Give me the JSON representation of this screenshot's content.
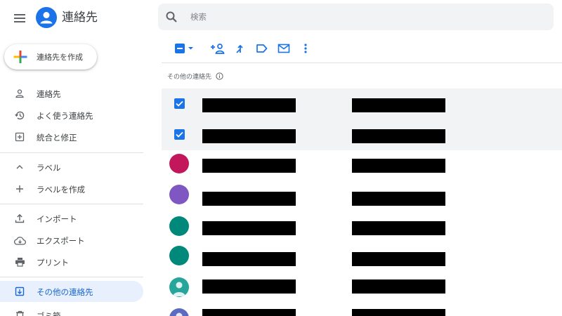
{
  "app": {
    "title": "連絡先",
    "create_label": "連絡先を作成"
  },
  "sidebar": {
    "items": [
      {
        "label": "連絡先",
        "icon": "person-icon"
      },
      {
        "label": "よく使う連絡先",
        "icon": "history-icon"
      },
      {
        "label": "統合と修正",
        "icon": "merge-icon"
      },
      {
        "label": "ラベル",
        "icon": "chevron-up-icon"
      },
      {
        "label": "ラベルを作成",
        "icon": "plus-icon"
      },
      {
        "label": "インポート",
        "icon": "upload-icon"
      },
      {
        "label": "エクスポート",
        "icon": "cloud-download-icon"
      },
      {
        "label": "プリント",
        "icon": "printer-icon"
      },
      {
        "label": "その他の連絡先",
        "icon": "other-contacts-icon",
        "active": true
      },
      {
        "label": "ゴミ箱",
        "icon": "trash-icon"
      }
    ]
  },
  "search": {
    "placeholder": "検索"
  },
  "section": {
    "title": "その他の連絡先"
  },
  "colors": {
    "accent": "#1a73e8",
    "active_bg": "#e8f0fe",
    "avatar_crimson": "#c2185b",
    "avatar_purple": "#7e57c2",
    "avatar_teal": "#00897b",
    "avatar_photo": "#26a69a",
    "avatar_indigo": "#5c6bc0"
  },
  "contacts": [
    {
      "state": "checked"
    },
    {
      "state": "checked"
    },
    {
      "state": "avatar",
      "avatar_color": "#c2185b"
    },
    {
      "state": "avatar",
      "avatar_color": "#7e57c2"
    },
    {
      "state": "avatar",
      "avatar_color": "#00897b"
    },
    {
      "state": "avatar",
      "avatar_color": "#00897b"
    },
    {
      "state": "avatar-photo",
      "avatar_color": "#26a69a"
    },
    {
      "state": "avatar-photo",
      "avatar_color": "#5c6bc0"
    }
  ]
}
